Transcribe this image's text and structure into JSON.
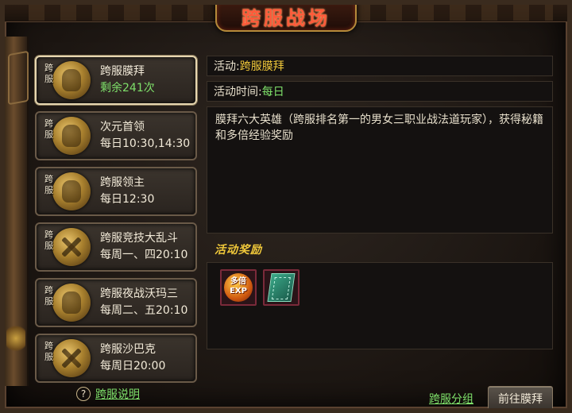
{
  "window": {
    "title": "跨服战场"
  },
  "events": [
    {
      "tag": "跨服",
      "name": "跨服膜拜",
      "sub": "剩余241次",
      "sub_style": "green",
      "icon": "golden-warrior-icon",
      "active": true
    },
    {
      "tag": "跨服",
      "name": "次元首领",
      "sub": "每日10:30,14:30",
      "sub_style": "normal",
      "icon": "dragon-boss-icon",
      "active": false
    },
    {
      "tag": "跨服",
      "name": "跨服领主",
      "sub": "每日12:30",
      "sub_style": "normal",
      "icon": "bull-lord-icon",
      "active": false
    },
    {
      "tag": "跨服",
      "name": "跨服竞技大乱斗",
      "sub": "每周一、四20:10",
      "sub_style": "normal",
      "icon": "crossed-swords-icon",
      "active": false
    },
    {
      "tag": "跨服",
      "name": "跨服夜战沃玛三",
      "sub": "每周二、五20:10",
      "sub_style": "normal",
      "icon": "demon-beast-icon",
      "active": false
    },
    {
      "tag": "跨服",
      "name": "跨服沙巴克",
      "sub": "每周日20:00",
      "sub_style": "normal",
      "icon": "crossed-swords-icon",
      "active": false
    }
  ],
  "help": {
    "icon_text": "?",
    "label": "跨服说明"
  },
  "detail": {
    "activity_label": "活动:",
    "activity_value": "跨服膜拜",
    "time_label": "活动时间:",
    "time_value": "每日",
    "description": "膜拜六大英雄（跨服排名第一的男女三职业战法道玩家），获得秘籍和多倍经验奖励",
    "reward_title": "活动奖励",
    "rewards": [
      {
        "icon": "multi-exp-icon",
        "text_top": "多倍",
        "text_bottom": "EXP"
      },
      {
        "icon": "skill-book-icon"
      }
    ]
  },
  "actions": {
    "group_link": "跨服分组",
    "go_button": "前往膜拜"
  },
  "colors": {
    "accent_green": "#7ee06a",
    "accent_gold": "#f0c83a",
    "title_red": "#ff5a3a"
  }
}
